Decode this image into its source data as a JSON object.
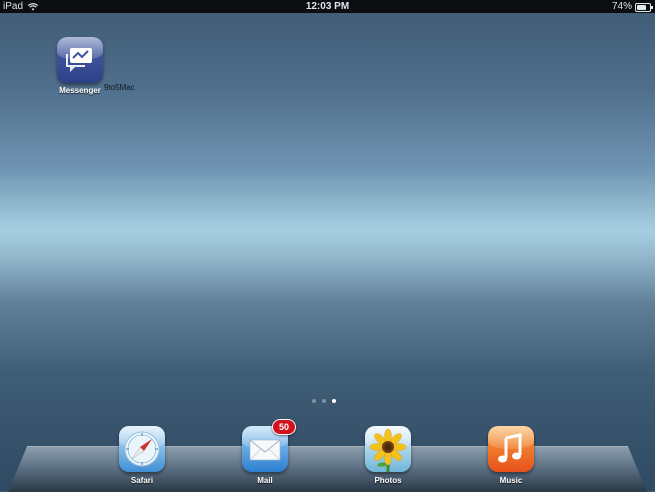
{
  "status_bar": {
    "device": "iPad",
    "time": "12:03 PM",
    "battery_percent_text": "74%",
    "battery_level": 0.74,
    "wifi_icon": "wifi-icon"
  },
  "home_screen": {
    "apps": [
      {
        "label": "Messenger",
        "icon": "messenger-icon"
      }
    ],
    "watermark": "9to5Mac",
    "page_dots": {
      "count": 3,
      "active_index": 2
    }
  },
  "dock": {
    "apps": [
      {
        "label": "Safari",
        "icon": "compass-icon"
      },
      {
        "label": "Mail",
        "icon": "envelope-icon",
        "badge": "50"
      },
      {
        "label": "Photos",
        "icon": "sunflower-icon"
      },
      {
        "label": "Music",
        "icon": "music-note-icon"
      }
    ]
  },
  "colors": {
    "messenger_blue": "#3b539a",
    "badge_red": "#d3121d",
    "music_orange": "#ee6a25"
  }
}
